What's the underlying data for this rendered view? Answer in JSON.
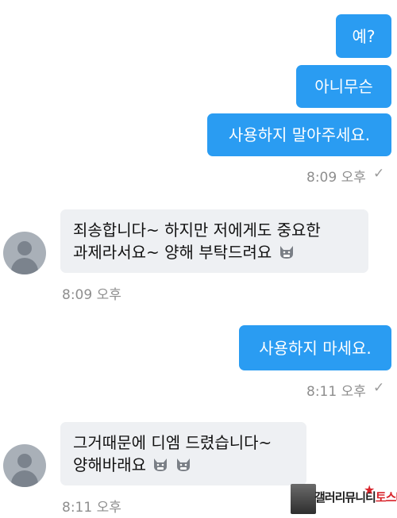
{
  "messages": {
    "out1": "예?",
    "out2": "아니무슨",
    "out3": "사용하지 말아주세요.",
    "time1": "8:09 오후",
    "in1_line1": "죄송합니다~ 하지만 저에게도 중요한",
    "in1_line2": "과제라서요~ 양해 부탁드려요",
    "time2": "8:09 오후",
    "out4": "사용하지 마세요.",
    "time3": "8:11 오후",
    "in2_line1": "그거때문에 디엠 드렸습니다~",
    "in2_line2": "양해바래요",
    "time4": "8:11 오후"
  },
  "icons": {
    "read_check": "✓",
    "emoji": "grinning-cat-face"
  },
  "watermark": {
    "brand_black": "갤러리뮤니티",
    "brand_red": "토스타"
  },
  "colors": {
    "outgoing_bubble": "#2a9cf2",
    "incoming_bubble": "#eef0f3",
    "timestamp": "#8e8e8e"
  }
}
